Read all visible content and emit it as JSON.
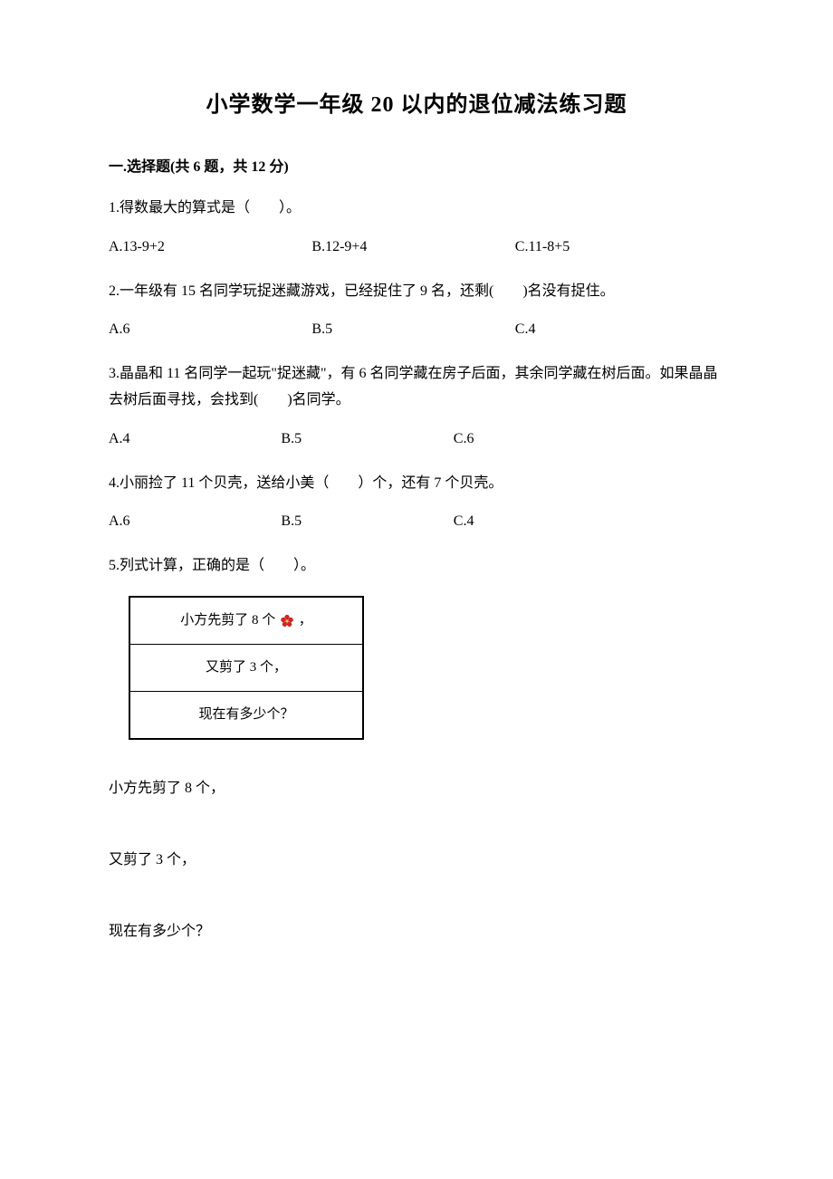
{
  "title": "小学数学一年级 20 以内的退位减法练习题",
  "section": {
    "header": "一.选择题(共 6 题，共 12 分)"
  },
  "q1": {
    "text": "1.得数最大的算式是（　　）。",
    "a": "A.13-9+2",
    "b": "B.12-9+4",
    "c": "C.11-8+5"
  },
  "q2": {
    "text": "2.一年级有 15 名同学玩捉迷藏游戏，已经捉住了 9 名，还剩(　　)名没有捉住。",
    "a": "A.6",
    "b": "B.5",
    "c": "C.4"
  },
  "q3": {
    "text": "3.晶晶和 11 名同学一起玩\"捉迷藏\"，有 6 名同学藏在房子后面，其余同学藏在树后面。如果晶晶去树后面寻找，会找到(　　)名同学。",
    "a": "A.4",
    "b": "B.5",
    "c": "C.6"
  },
  "q4": {
    "text": "4.小丽捡了 11 个贝壳，送给小美（　　）个，还有 7 个贝壳。",
    "a": "A.6",
    "b": "B.5",
    "c": "C.4"
  },
  "q5": {
    "text": "5.列式计算，正确的是（　　）。",
    "box": {
      "row1_pre": "小方先剪了 8 个",
      "row1_post": "，",
      "row2": "又剪了 3 个，",
      "row3": "现在有多少个？"
    },
    "repeat": {
      "line1": "小方先剪了 8 个，",
      "line2": "又剪了 3 个，",
      "line3": "现在有多少个？"
    }
  }
}
